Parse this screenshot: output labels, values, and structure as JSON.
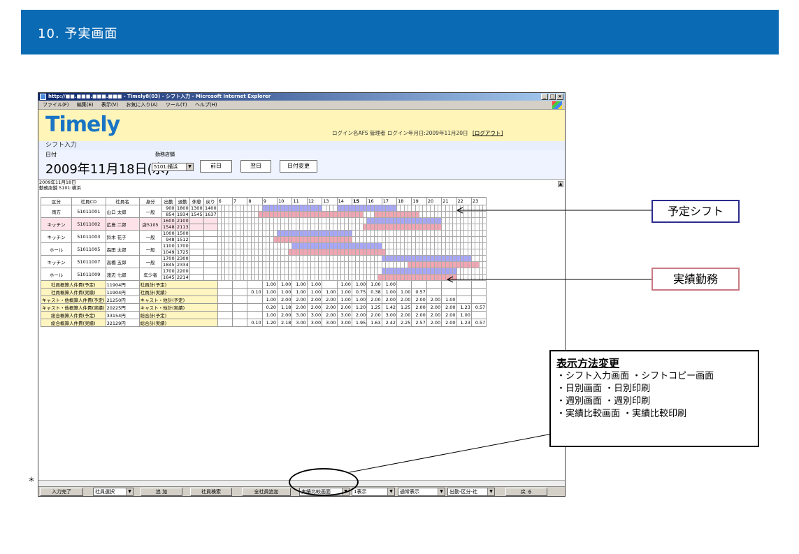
{
  "page": {
    "title": "10. 予実画面"
  },
  "window": {
    "title": "http://■■.■■■.■■■.■■■ - Timely8(03) - シフト入力 - Microsoft Internet Explorer",
    "menu": [
      "ファイル(F)",
      "編集(E)",
      "表示(V)",
      "お気に入り(A)",
      "ツール(T)",
      "ヘルプ(H)"
    ]
  },
  "app": {
    "logo": "Timely",
    "login": "ログイン名AFS 管理者 ログイン年月日:2009年11月20日",
    "logout": "[ログアウト]",
    "section": "シフト入力",
    "date_label": "日付",
    "store_label": "勤務店舗",
    "big_date": "2009年11月18日(水)",
    "store_value": "5101:横浜",
    "prev_button": "前日",
    "next_button": "翌日",
    "change_date_button": "日付変更",
    "sub_date": "2009年11月18日",
    "sub_store": "勤務店舗 5101:横浜"
  },
  "table": {
    "headers": [
      "区分",
      "社員CD",
      "社員名",
      "身分",
      "出勤",
      "退勤",
      "休憩",
      "戻り"
    ],
    "hours": [
      "6",
      "7",
      "8",
      "9",
      "10",
      "11",
      "12",
      "13",
      "14",
      "15",
      "16",
      "17",
      "18",
      "19",
      "20",
      "21",
      "22",
      "23"
    ],
    "rows": [
      {
        "kubun": "両方",
        "cd": "51011001",
        "name": "山口 太郎",
        "mibun": "一般",
        "plan": [
          "900",
          "1800",
          "1300",
          "1400"
        ],
        "act": [
          "854",
          "1934",
          "1545",
          "1637"
        ]
      },
      {
        "kubun": "キッチン",
        "cd": "51011002",
        "name": "広島 二郎",
        "mibun": "店5105",
        "plan": [
          "1600",
          "2100",
          "",
          ""
        ],
        "act": [
          "1548",
          "2113",
          "",
          ""
        ]
      },
      {
        "kubun": "キッチン",
        "cd": "51011003",
        "name": "鈴木 花子",
        "mibun": "一般",
        "plan": [
          "1000",
          "1500",
          "",
          ""
        ],
        "act": [
          "948",
          "1512",
          "",
          ""
        ]
      },
      {
        "kubun": "ホール",
        "cd": "51011005",
        "name": "森田 太郎",
        "mibun": "一般",
        "plan": [
          "1100",
          "1700",
          "",
          ""
        ],
        "act": [
          "1049",
          "1725",
          "",
          ""
        ]
      },
      {
        "kubun": "キッチン",
        "cd": "51011007",
        "name": "高橋 五郎",
        "mibun": "一般",
        "plan": [
          "1700",
          "2300",
          "",
          ""
        ],
        "act": [
          "1845",
          "2334",
          "",
          ""
        ]
      },
      {
        "kubun": "ホール",
        "cd": "51011009",
        "name": "渡辺 七郎",
        "mibun": "年少者",
        "plan": [
          "1700",
          "2200",
          "",
          ""
        ],
        "act": [
          "1645",
          "2214",
          "",
          ""
        ]
      }
    ],
    "summary": [
      {
        "label": "社員概算人件費(予定)",
        "value": "11904円",
        "label2": "社員計(予定)",
        "cells": [
          "",
          "",
          "",
          "1.00",
          "1.00",
          "1.00",
          "1.00",
          "",
          "1.00",
          "1.00",
          "1.00",
          "1.00",
          "",
          "",
          "",
          "",
          "",
          ""
        ]
      },
      {
        "label": "社員概算人件費(実績)",
        "value": "11904円",
        "label2": "社員計(実績)",
        "cells": [
          "",
          "",
          "0.10",
          "1.00",
          "1.00",
          "1.00",
          "1.00",
          "1.00",
          "1.00",
          "0.75",
          "0.38",
          "1.00",
          "1.00",
          "0.57",
          "",
          "",
          "",
          ""
        ]
      },
      {
        "label": "キャスト・他概算人件費(予定)",
        "value": "21250円",
        "label2": "キャスト・他計(予定)",
        "cells": [
          "",
          "",
          "",
          "1.00",
          "2.00",
          "2.00",
          "2.00",
          "2.00",
          "1.00",
          "1.00",
          "2.00",
          "2.00",
          "2.00",
          "2.00",
          "2.00",
          "1.00",
          "",
          ""
        ]
      },
      {
        "label": "キャスト・他概算人件費(実績)",
        "value": "20225円",
        "label2": "キャスト・他計(実績)",
        "cells": [
          "",
          "",
          "",
          "0.20",
          "1.18",
          "2.00",
          "2.00",
          "2.00",
          "2.00",
          "1.20",
          "1.25",
          "1.42",
          "1.25",
          "2.00",
          "2.00",
          "2.00",
          "1.23",
          "0.57"
        ]
      },
      {
        "label": "総合概算人件費(予定)",
        "value": "33154円",
        "label2": "総合計(予定)",
        "cells": [
          "",
          "",
          "",
          "1.00",
          "2.00",
          "3.00",
          "3.00",
          "2.00",
          "3.00",
          "2.00",
          "2.00",
          "3.00",
          "2.00",
          "2.00",
          "2.00",
          "2.00",
          "1.00",
          ""
        ]
      },
      {
        "label": "総合概算人件費(実績)",
        "value": "32129円",
        "label2": "総合計(実績)",
        "cells": [
          "",
          "",
          "0.10",
          "1.20",
          "2.18",
          "3.00",
          "3.00",
          "3.00",
          "3.00",
          "1.95",
          "1.63",
          "2.42",
          "2.25",
          "2.57",
          "2.00",
          "2.00",
          "1.23",
          "0.57"
        ]
      }
    ]
  },
  "bottom": {
    "input_done": "入力完了",
    "emp_select": "社員選択",
    "add": "追 加",
    "emp_search": "社員検索",
    "all_add": "全社員追加",
    "view_mode": "実績比較画面",
    "view_1": "1表示",
    "normal": "通常表示",
    "sort": "出勤-区分-社",
    "back": "戻 る"
  },
  "callouts": {
    "plan": "予定シフト",
    "actual": "実績勤務",
    "display_title": "表示方法変更",
    "display_lines": [
      "・シフト入力画面 ・シフトコピー画面",
      "・日別画面 ・日別印刷",
      "・週別画面 ・週別印刷",
      "・実績比較画面 ・実績比較印刷"
    ]
  },
  "left_mark": "＊"
}
